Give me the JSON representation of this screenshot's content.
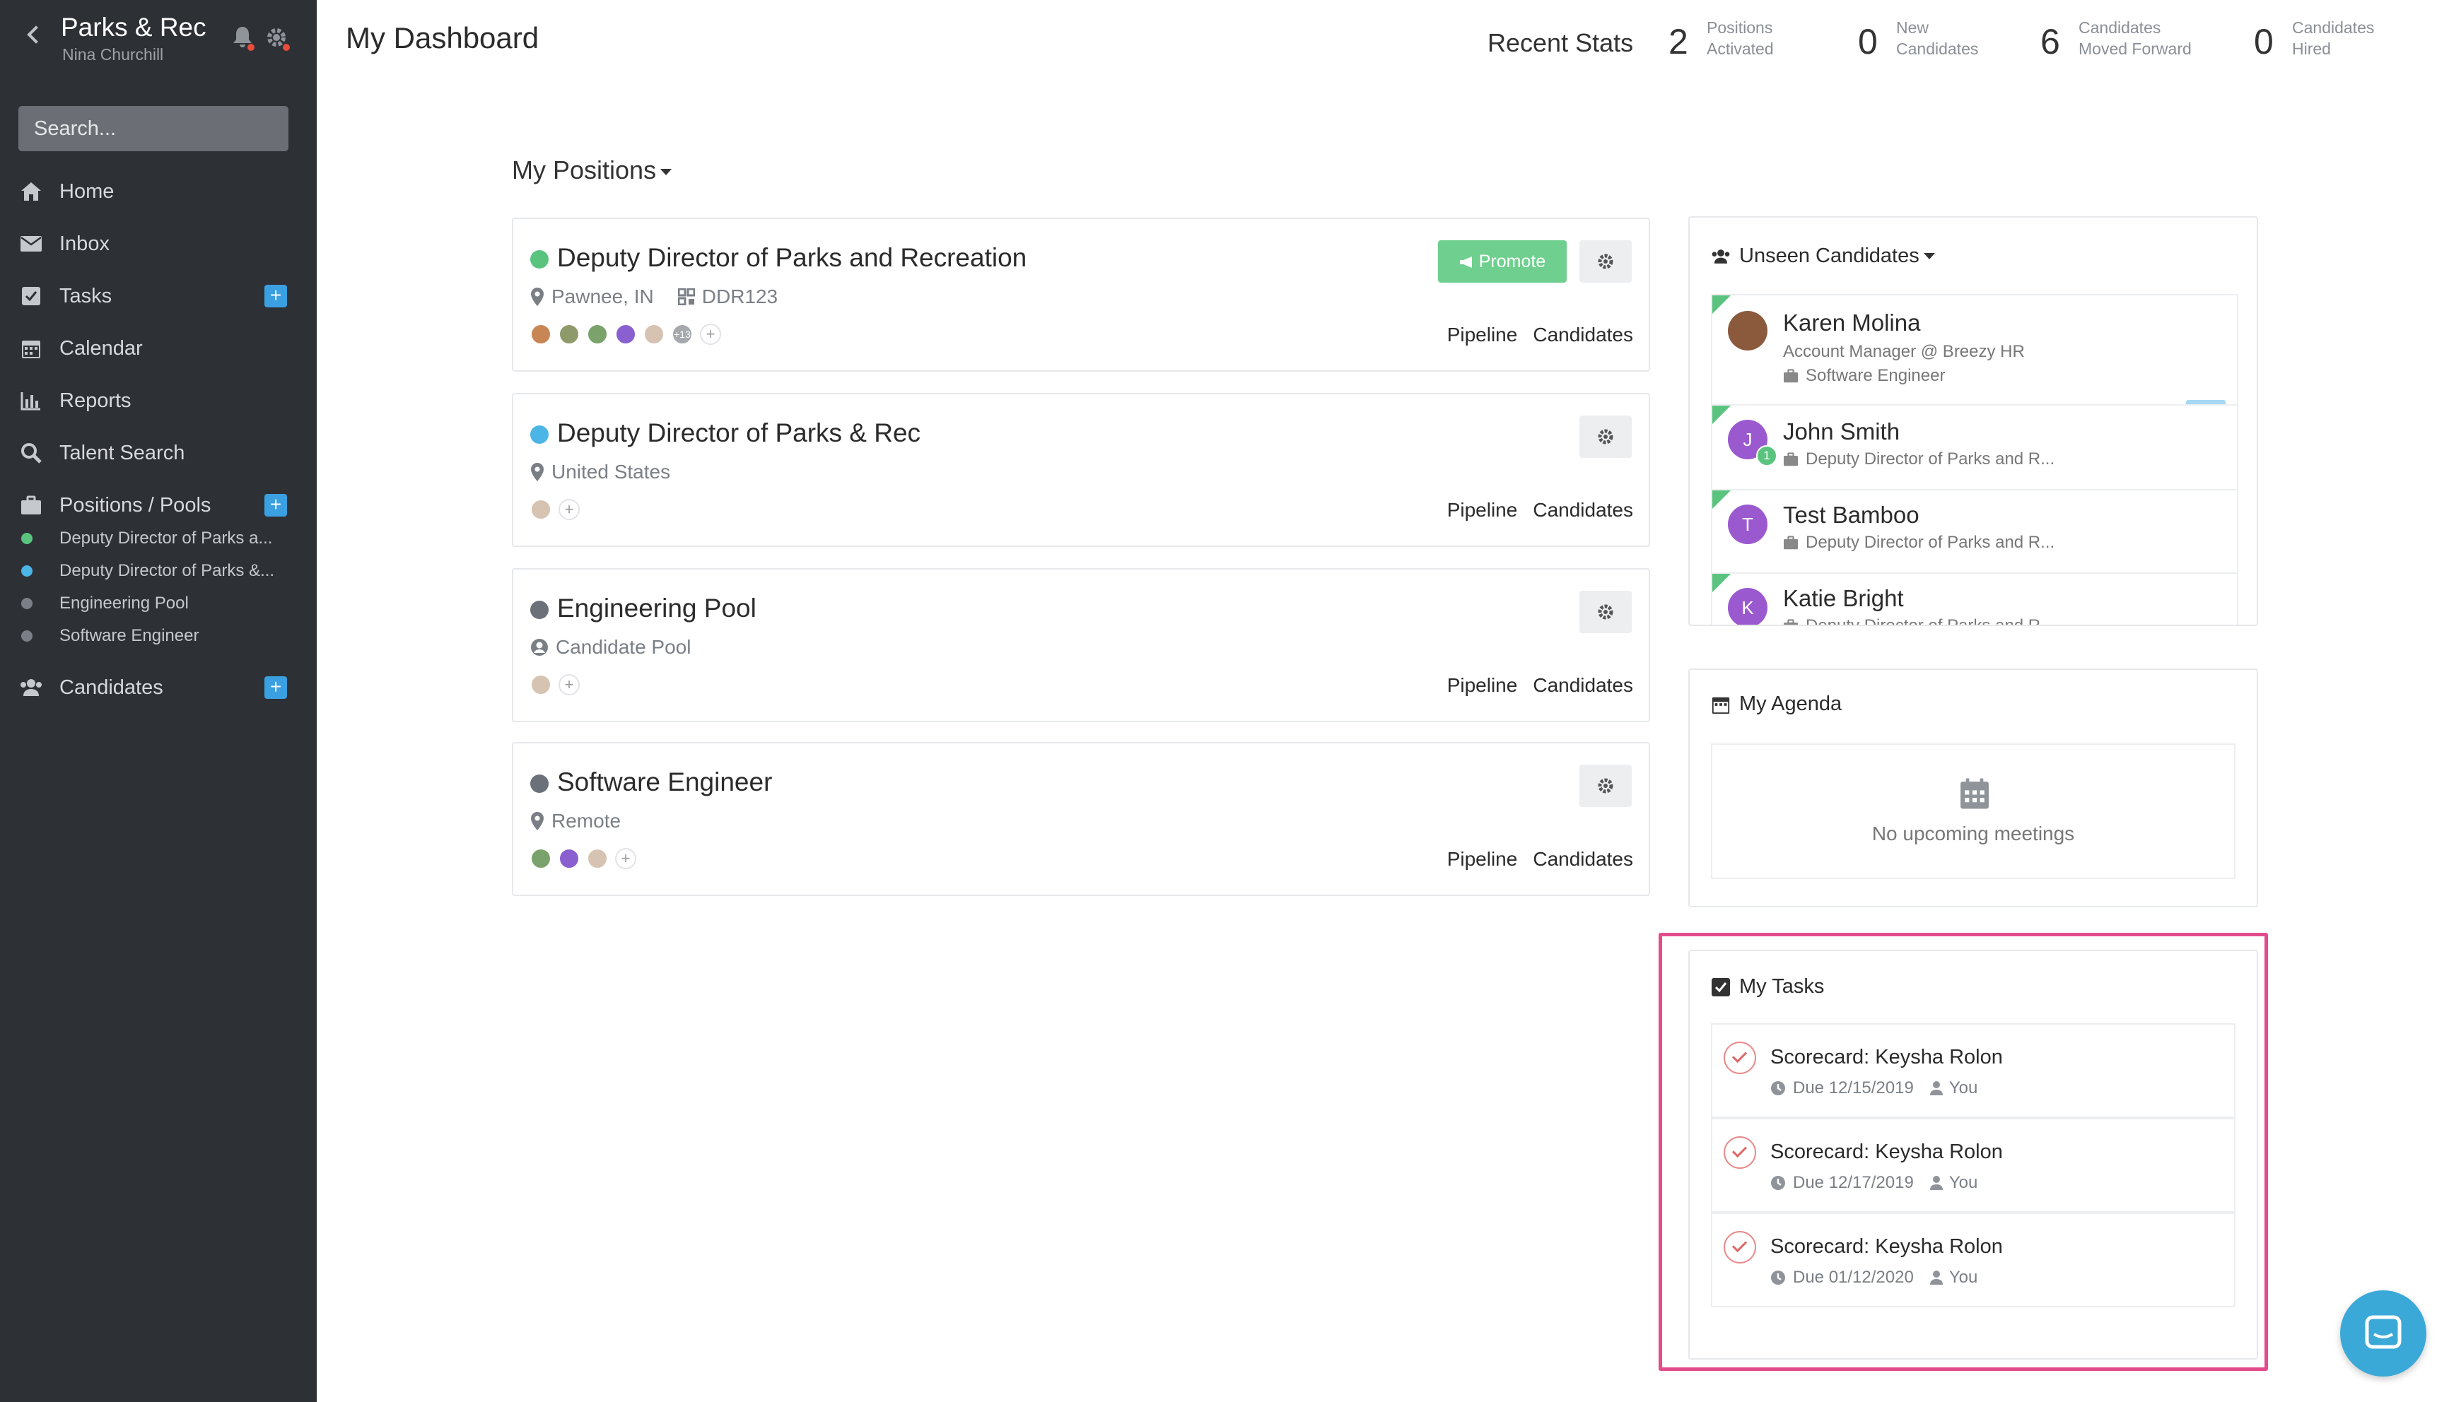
{
  "sidebar": {
    "org": "Parks & Rec",
    "user": "Nina Churchill",
    "search_placeholder": "Search...",
    "nav": [
      {
        "label": "Home"
      },
      {
        "label": "Inbox"
      },
      {
        "label": "Tasks"
      },
      {
        "label": "Calendar"
      },
      {
        "label": "Reports"
      },
      {
        "label": "Talent Search"
      },
      {
        "label": "Positions / Pools"
      }
    ],
    "positions": [
      {
        "label": "Deputy Director of Parks a...",
        "color": "#5ac47e"
      },
      {
        "label": "Deputy Director of Parks &...",
        "color": "#4bb5e6"
      },
      {
        "label": "Engineering Pool",
        "color": "#7b8088"
      },
      {
        "label": "Software Engineer",
        "color": "#7b8088"
      }
    ],
    "candidates_label": "Candidates"
  },
  "header": {
    "title": "My Dashboard",
    "recent_label": "Recent Stats",
    "stats": [
      {
        "value": "2",
        "line1": "Positions",
        "line2": "Activated"
      },
      {
        "value": "0",
        "line1": "New",
        "line2": "Candidates"
      },
      {
        "value": "6",
        "line1": "Candidates",
        "line2": "Moved Forward"
      },
      {
        "value": "0",
        "line1": "Candidates",
        "line2": "Hired"
      }
    ]
  },
  "positions": {
    "heading": "My Positions",
    "pipeline_label": "Pipeline",
    "candidates_label": "Candidates",
    "promote_label": "Promote",
    "items": [
      {
        "title": "Deputy Director of Parks and Recreation",
        "location": "Pawnee, IN",
        "code": "DDR123",
        "more_avatars": "+13",
        "status_color": "#5ac47e"
      },
      {
        "title": "Deputy Director of Parks & Rec",
        "location": "United States",
        "status_color": "#4bb5e6"
      },
      {
        "title": "Engineering Pool",
        "location": "Candidate Pool",
        "status_color": "#6b7079"
      },
      {
        "title": "Software Engineer",
        "location": "Remote",
        "status_color": "#6b7079"
      }
    ]
  },
  "unseen": {
    "heading": "Unseen Candidates",
    "items": [
      {
        "name": "Karen Molina",
        "title": "Account Manager @ Breezy HR",
        "position": "Software Engineer",
        "initial": ""
      },
      {
        "name": "John Smith",
        "position": "Deputy Director of Parks and R...",
        "initial": "J",
        "badge": "1"
      },
      {
        "name": "Test Bamboo",
        "position": "Deputy Director of Parks and R...",
        "initial": "T"
      },
      {
        "name": "Katie Bright",
        "position": "Deputy Director of Parks and R...",
        "initial": "K"
      }
    ]
  },
  "agenda": {
    "heading": "My Agenda",
    "empty": "No upcoming meetings"
  },
  "tasks": {
    "heading": "My Tasks",
    "items": [
      {
        "title": "Scorecard: Keysha Rolon",
        "due": "Due 12/15/2019",
        "assignee": "You"
      },
      {
        "title": "Scorecard: Keysha Rolon",
        "due": "Due 12/17/2019",
        "assignee": "You"
      },
      {
        "title": "Scorecard: Keysha Rolon",
        "due": "Due 01/12/2020",
        "assignee": "You"
      }
    ]
  },
  "colors": {
    "accent": "#3aa0e2",
    "promote": "#6fcf8e",
    "highlight": "#e34c8c"
  }
}
